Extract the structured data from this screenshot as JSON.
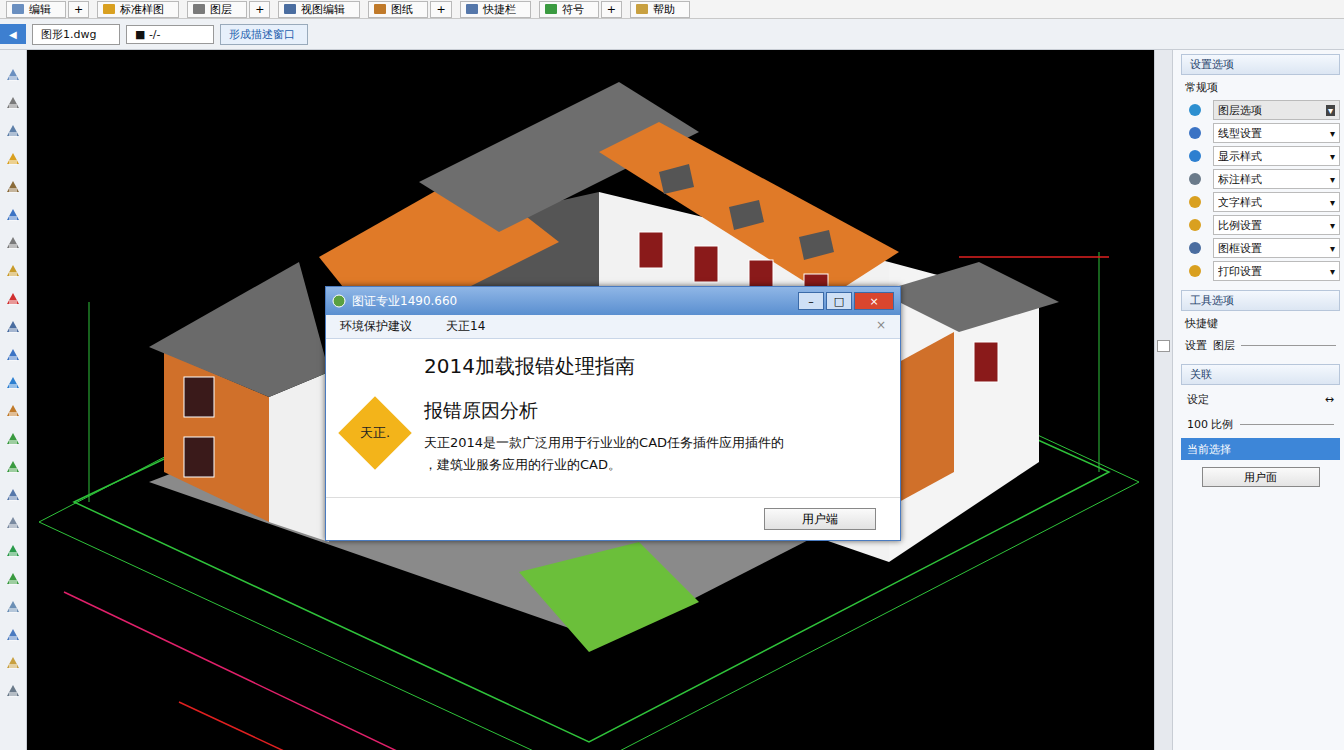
{
  "window": {
    "title": "图证专业1490.660"
  },
  "toolbar": {
    "plus_glyph": "+",
    "items": [
      {
        "label": "编辑",
        "has_plus": true
      },
      {
        "label": "标准样图",
        "has_plus": false
      },
      {
        "label": "图层",
        "has_plus": true
      },
      {
        "label": "视图编辑",
        "has_plus": false
      },
      {
        "label": "图纸",
        "has_plus": true
      },
      {
        "label": "快捷栏",
        "has_plus": false
      },
      {
        "label": "符号",
        "has_plus": true
      },
      {
        "label": "帮助",
        "has_plus": false
      }
    ]
  },
  "doc_bar": {
    "back_glyph": "◀",
    "tabs": [
      {
        "label": "图形1.dwg",
        "selected": false
      },
      {
        "label": "■ -/-",
        "selected": false
      },
      {
        "label": "形成描述窗口",
        "selected": true
      }
    ]
  },
  "dialog": {
    "title": "图证专业1490.660",
    "minimize": "–",
    "maximize": "□",
    "close": "×",
    "menu": [
      "环境保护建议",
      "天正14"
    ],
    "menu_close": "×",
    "badge": "天正.",
    "heading": "2014加载报错处理指南",
    "subheading": "报错原因分析",
    "body": [
      "天正2014是一款广泛用用于行业业的CAD任务插件应用插件的",
      "，建筑业服务应用的行业的CAD。"
    ],
    "buttons": [
      "用户端"
    ]
  },
  "panel": {
    "dropdown_glyph": "▾",
    "settings": {
      "title": "设置选项",
      "subtitle": "常规项",
      "rows": [
        {
          "label": "图层选项",
          "selected": true
        },
        {
          "label": "线型设置",
          "selected": false
        },
        {
          "label": "显示样式",
          "selected": false
        },
        {
          "label": "标注样式",
          "selected": false
        },
        {
          "label": "文字样式",
          "selected": false
        },
        {
          "label": "比例设置",
          "selected": false
        },
        {
          "label": "图框设置",
          "selected": false
        },
        {
          "label": "打印设置",
          "selected": false
        }
      ]
    },
    "tools": {
      "title": "工具选项",
      "subtitle": "快捷键",
      "row_label": "设置",
      "row_value": "图层"
    },
    "relations": {
      "title": "关联",
      "rows": [
        {
          "label": "设定",
          "value": "↔",
          "selected": false
        },
        {
          "label": "100 比例",
          "value": "",
          "selected": false
        },
        {
          "label": "当前选择",
          "value": "",
          "selected": true
        }
      ],
      "button": "用户面"
    }
  }
}
